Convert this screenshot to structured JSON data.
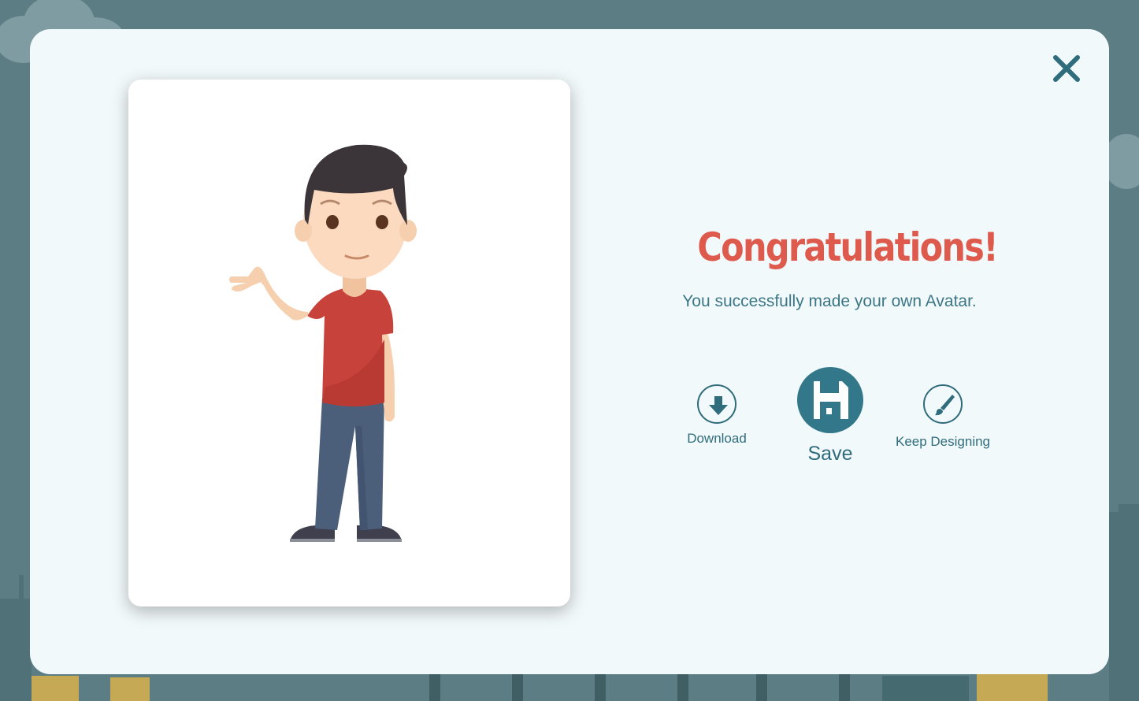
{
  "background": {
    "colors": {
      "sky": "#5b7d83",
      "cloud": "#7e9ca1",
      "building": "#4f7177",
      "window": "#e0b44a"
    }
  },
  "modal": {
    "close_icon": "close-icon",
    "avatar_image": "avatar-figure",
    "congrats": {
      "title": "Congratulations!",
      "subtitle": "You successfully made your own Avatar."
    },
    "actions": {
      "download": {
        "label": "Download",
        "icon": "download-arrow-icon"
      },
      "save": {
        "label": "Save",
        "icon": "floppy-disk-icon"
      },
      "keep_designing": {
        "label": "Keep Designing",
        "icon": "paintbrush-icon"
      }
    },
    "colors": {
      "accent": "#2f6c7c",
      "title": "#dd5a4d",
      "panel": "#f2f9fb"
    }
  }
}
